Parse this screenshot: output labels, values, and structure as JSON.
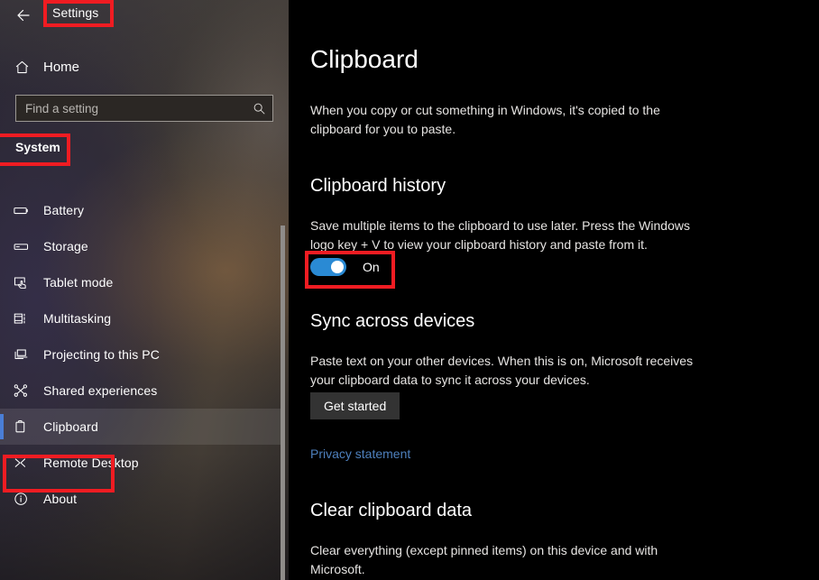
{
  "window": {
    "app_title": "Settings",
    "back_icon": "back-arrow-icon"
  },
  "sidebar": {
    "home": {
      "label": "Home",
      "icon": "home-icon"
    },
    "search": {
      "placeholder": "Find a setting",
      "value": "",
      "icon": "search-icon"
    },
    "group_header": "System",
    "items": [
      {
        "label": "Battery",
        "icon": "battery-icon",
        "selected": false
      },
      {
        "label": "Storage",
        "icon": "storage-drive-icon",
        "selected": false
      },
      {
        "label": "Tablet mode",
        "icon": "tablet-mode-icon",
        "selected": false
      },
      {
        "label": "Multitasking",
        "icon": "multitasking-icon",
        "selected": false
      },
      {
        "label": "Projecting to this PC",
        "icon": "projecting-icon",
        "selected": false
      },
      {
        "label": "Shared experiences",
        "icon": "shared-experiences-icon",
        "selected": false
      },
      {
        "label": "Clipboard",
        "icon": "clipboard-icon",
        "selected": true
      },
      {
        "label": "Remote Desktop",
        "icon": "remote-desktop-icon",
        "selected": false
      },
      {
        "label": "About",
        "icon": "info-icon",
        "selected": false
      }
    ]
  },
  "main": {
    "page_title": "Clipboard",
    "intro": "When you copy or cut something in Windows, it's copied to the clipboard for you to paste.",
    "clipboard_history": {
      "title": "Clipboard history",
      "description": "Save multiple items to the clipboard to use later. Press the Windows logo key + V to view your clipboard history and paste from it.",
      "toggle_state": "On"
    },
    "sync_across_devices": {
      "title": "Sync across devices",
      "description": "Paste text on your other devices. When this is on, Microsoft receives your clipboard data to sync it across your devices.",
      "button_label": "Get started",
      "link_label": "Privacy statement"
    },
    "clear_clipboard_data": {
      "title": "Clear clipboard data",
      "description": "Clear everything (except pinned items) on this device and with Microsoft."
    }
  },
  "colors": {
    "accent_blue": "#2a8ad4",
    "selection_bar": "#4a7ed6",
    "link_blue": "#4e80bd",
    "annotation_red": "#f01c22",
    "main_background": "#000000",
    "button_background": "#333333"
  },
  "annotations": {
    "highlights": [
      {
        "target": "app-title"
      },
      {
        "target": "group-header-system"
      },
      {
        "target": "sidebar-item-clipboard"
      },
      {
        "target": "clipboard-history-toggle"
      }
    ]
  }
}
